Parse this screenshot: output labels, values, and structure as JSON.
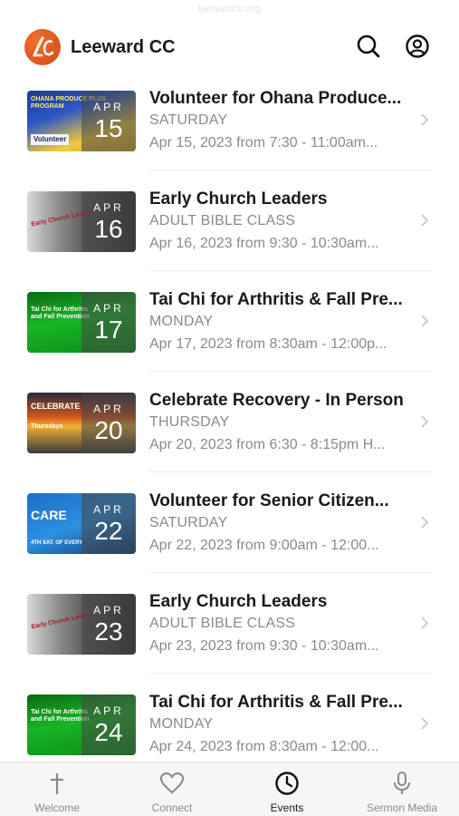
{
  "status": {
    "hint": "leewardcc.org"
  },
  "app": {
    "title": "Leeward CC",
    "logo_icon": "leeward-cc-logo"
  },
  "header": {
    "search_icon": "search-icon",
    "account_icon": "account-icon"
  },
  "events": [
    {
      "title": "Volunteer for Ohana Produce...",
      "subtitle": "SATURDAY",
      "when": "Apr 15, 2023 from 7:30 - 11:00am...",
      "month": "APR",
      "day": "15",
      "thumb_text": "OHANA PRODUCE PLUS PROGRAM",
      "thumb_caption": "Volunteer"
    },
    {
      "title": "Early Church Leaders",
      "subtitle": "ADULT BIBLE CLASS",
      "when": "Apr 16, 2023 from 9:30 - 10:30am...",
      "month": "APR",
      "day": "16",
      "thumb_text": "Early Church Leaders",
      "thumb_caption": ""
    },
    {
      "title": "Tai Chi for Arthritis & Fall Pre...",
      "subtitle": "MONDAY",
      "when": "Apr 17, 2023 from 8:30am - 12:00p...",
      "month": "APR",
      "day": "17",
      "thumb_text": "Tai Chi for Arthritis and Fall Prevention",
      "thumb_caption": ""
    },
    {
      "title": "Celebrate Recovery - In Person",
      "subtitle": "THURSDAY",
      "when": "Apr 20, 2023 from 6:30 - 8:15pm H...",
      "month": "APR",
      "day": "20",
      "thumb_text": "CELEBRATE",
      "thumb_caption": "Thursdays"
    },
    {
      "title": "Volunteer for Senior Citizen...",
      "subtitle": "SATURDAY",
      "when": "Apr 22, 2023 from 9:00am - 12:00...",
      "month": "APR",
      "day": "22",
      "thumb_text": "CARE",
      "thumb_caption": "4TH SAT. OF EVERY"
    },
    {
      "title": "Early Church Leaders",
      "subtitle": "ADULT BIBLE CLASS",
      "when": "Apr 23, 2023 from 9:30 - 10:30am...",
      "month": "APR",
      "day": "23",
      "thumb_text": "Early Church Leaders",
      "thumb_caption": ""
    },
    {
      "title": "Tai Chi for Arthritis & Fall Pre...",
      "subtitle": "MONDAY",
      "when": "Apr 24, 2023 from 8:30am - 12:00...",
      "month": "APR",
      "day": "24",
      "thumb_text": "Tai Chi for Arthritis and Fall Prevention",
      "thumb_caption": ""
    }
  ],
  "tabs": [
    {
      "label": "Welcome",
      "icon": "cross-icon"
    },
    {
      "label": "Connect",
      "icon": "heart-icon"
    },
    {
      "label": "Events",
      "icon": "clock-icon",
      "active": true
    },
    {
      "label": "Sermon Media",
      "icon": "microphone-icon"
    }
  ],
  "colors": {
    "brand": "#e05a22",
    "text": "#1a1a1a",
    "muted": "#8a8a8a",
    "tabbar": "#f6f6f6"
  }
}
